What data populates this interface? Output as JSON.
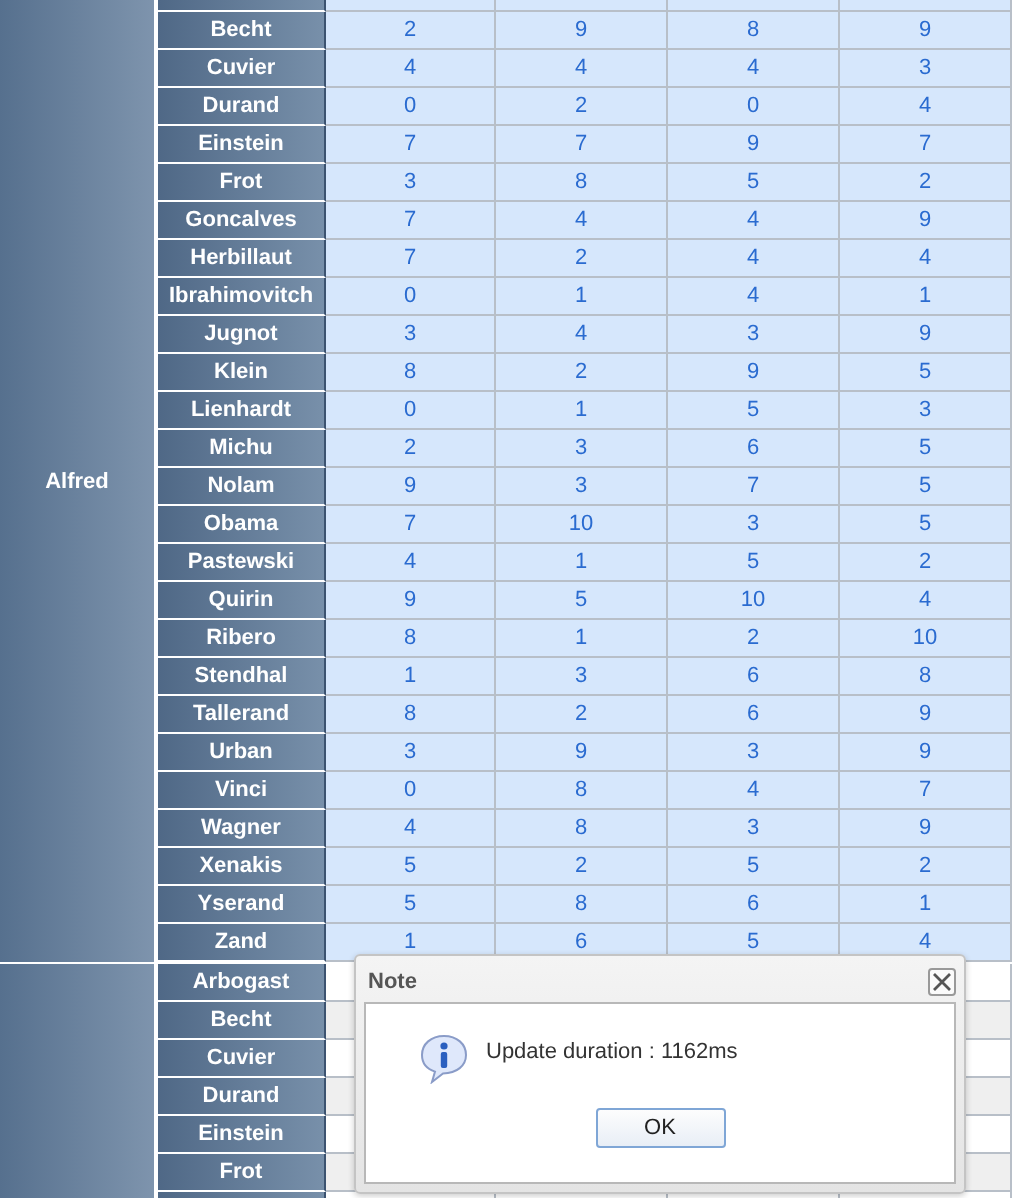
{
  "groups": [
    {
      "name": "Alfred",
      "rows": [
        {
          "name": "Becht",
          "values": [
            "2",
            "9",
            "8",
            "9"
          ]
        },
        {
          "name": "Cuvier",
          "values": [
            "4",
            "4",
            "4",
            "3"
          ]
        },
        {
          "name": "Durand",
          "values": [
            "0",
            "2",
            "0",
            "4"
          ]
        },
        {
          "name": "Einstein",
          "values": [
            "7",
            "7",
            "9",
            "7"
          ]
        },
        {
          "name": "Frot",
          "values": [
            "3",
            "8",
            "5",
            "2"
          ]
        },
        {
          "name": "Goncalves",
          "values": [
            "7",
            "4",
            "4",
            "9"
          ]
        },
        {
          "name": "Herbillaut",
          "values": [
            "7",
            "2",
            "4",
            "4"
          ]
        },
        {
          "name": "Ibrahimovitch",
          "values": [
            "0",
            "1",
            "4",
            "1"
          ]
        },
        {
          "name": "Jugnot",
          "values": [
            "3",
            "4",
            "3",
            "9"
          ]
        },
        {
          "name": "Klein",
          "values": [
            "8",
            "2",
            "9",
            "5"
          ]
        },
        {
          "name": "Lienhardt",
          "values": [
            "0",
            "1",
            "5",
            "3"
          ]
        },
        {
          "name": "Michu",
          "values": [
            "2",
            "3",
            "6",
            "5"
          ]
        },
        {
          "name": "Nolam",
          "values": [
            "9",
            "3",
            "7",
            "5"
          ]
        },
        {
          "name": "Obama",
          "values": [
            "7",
            "10",
            "3",
            "5"
          ]
        },
        {
          "name": "Pastewski",
          "values": [
            "4",
            "1",
            "5",
            "2"
          ]
        },
        {
          "name": "Quirin",
          "values": [
            "9",
            "5",
            "10",
            "4"
          ]
        },
        {
          "name": "Ribero",
          "values": [
            "8",
            "1",
            "2",
            "10"
          ]
        },
        {
          "name": "Stendhal",
          "values": [
            "1",
            "3",
            "6",
            "8"
          ]
        },
        {
          "name": "Tallerand",
          "values": [
            "8",
            "2",
            "6",
            "9"
          ]
        },
        {
          "name": "Urban",
          "values": [
            "3",
            "9",
            "3",
            "9"
          ]
        },
        {
          "name": "Vinci",
          "values": [
            "0",
            "8",
            "4",
            "7"
          ]
        },
        {
          "name": "Wagner",
          "values": [
            "4",
            "8",
            "3",
            "9"
          ]
        },
        {
          "name": "Xenakis",
          "values": [
            "5",
            "2",
            "5",
            "2"
          ]
        },
        {
          "name": "Yserand",
          "values": [
            "5",
            "8",
            "6",
            "1"
          ]
        },
        {
          "name": "Zand",
          "values": [
            "1",
            "6",
            "5",
            "4"
          ]
        }
      ]
    },
    {
      "rows": [
        {
          "name": "Arbogast"
        },
        {
          "name": "Becht"
        },
        {
          "name": "Cuvier"
        },
        {
          "name": "Durand"
        },
        {
          "name": "Einstein"
        },
        {
          "name": "Frot"
        }
      ]
    }
  ],
  "dialog": {
    "title": "Note",
    "message": "Update duration : 1162ms",
    "button": "OK"
  }
}
